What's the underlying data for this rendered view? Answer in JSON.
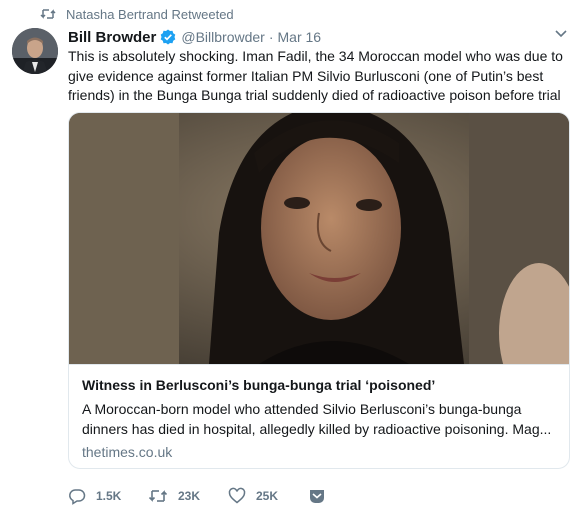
{
  "social_context": {
    "icon": "retweet-icon",
    "text": "Natasha Bertrand Retweeted"
  },
  "author": {
    "name": "Bill Browder",
    "verified": true,
    "handle": "@Billbrowder",
    "separator": "·",
    "date": "Mar 16"
  },
  "tweet": {
    "text": "This is absolutely shocking. Iman Fadil, the 34 Moroccan model who was due to give evidence against former Italian PM Silvio Burlusconi (one of Putin’s best friends) in the Bunga Bunga trial suddenly died of radioactive poison before trial"
  },
  "card": {
    "title": "Witness in Berlusconi’s bunga-bunga trial ‘poisoned’",
    "description": "A Moroccan-born model who attended Silvio Berlusconi’s bunga-bunga dinners has died in hospital, allegedly killed by radioactive poisoning. Mag...",
    "domain": "thetimes.co.uk"
  },
  "actions": {
    "reply_count": "1.5K",
    "retweet_count": "23K",
    "like_count": "25K"
  },
  "colors": {
    "accent": "#1da1f2",
    "muted": "#657786",
    "text": "#14171a",
    "border": "#e1e8ed"
  }
}
